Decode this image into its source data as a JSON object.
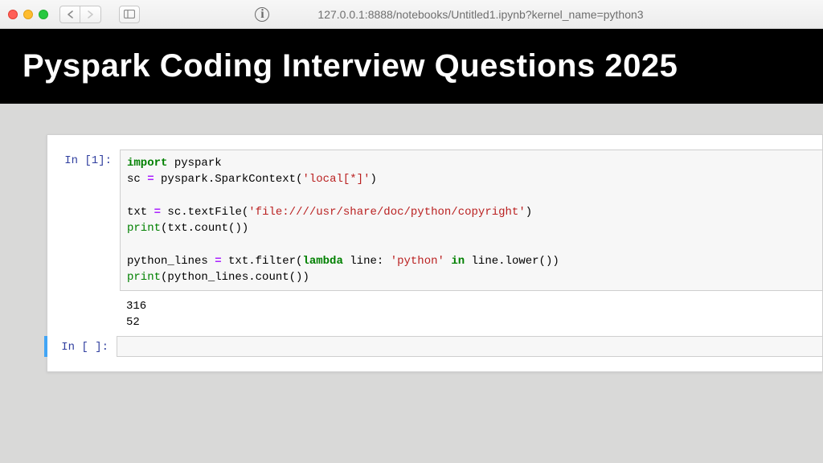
{
  "chrome": {
    "url": "127.0.0.1:8888/notebooks/Untitled1.ipynb?kernel_name=python3"
  },
  "banner": {
    "title": "Pyspark Coding Interview Questions 2025"
  },
  "notebook": {
    "cells": [
      {
        "prompt": "In [1]:",
        "code_tokens": [
          {
            "t": "import",
            "c": "kw"
          },
          {
            "t": " pyspark\n"
          },
          {
            "t": "sc "
          },
          {
            "t": "=",
            "c": "op"
          },
          {
            "t": " pyspark"
          },
          {
            "t": "."
          },
          {
            "t": "SparkContext("
          },
          {
            "t": "'local[*]'",
            "c": "str"
          },
          {
            "t": ")\n"
          },
          {
            "t": "\n"
          },
          {
            "t": "txt "
          },
          {
            "t": "=",
            "c": "op"
          },
          {
            "t": " sc"
          },
          {
            "t": "."
          },
          {
            "t": "textFile("
          },
          {
            "t": "'file:////usr/share/doc/python/copyright'",
            "c": "str"
          },
          {
            "t": ")\n"
          },
          {
            "t": "print",
            "c": "builtin"
          },
          {
            "t": "(txt"
          },
          {
            "t": "."
          },
          {
            "t": "count())\n"
          },
          {
            "t": "\n"
          },
          {
            "t": "python_lines "
          },
          {
            "t": "=",
            "c": "op"
          },
          {
            "t": " txt"
          },
          {
            "t": "."
          },
          {
            "t": "filter("
          },
          {
            "t": "lambda",
            "c": "kw"
          },
          {
            "t": " line: "
          },
          {
            "t": "'python'",
            "c": "str"
          },
          {
            "t": " "
          },
          {
            "t": "in",
            "c": "kw"
          },
          {
            "t": " line"
          },
          {
            "t": "."
          },
          {
            "t": "lower())\n"
          },
          {
            "t": "print",
            "c": "builtin"
          },
          {
            "t": "(python_lines"
          },
          {
            "t": "."
          },
          {
            "t": "count())"
          }
        ],
        "output": "316\n52"
      },
      {
        "prompt": "In [ ]:",
        "code_tokens": [],
        "output": null,
        "selected": true
      }
    ]
  }
}
